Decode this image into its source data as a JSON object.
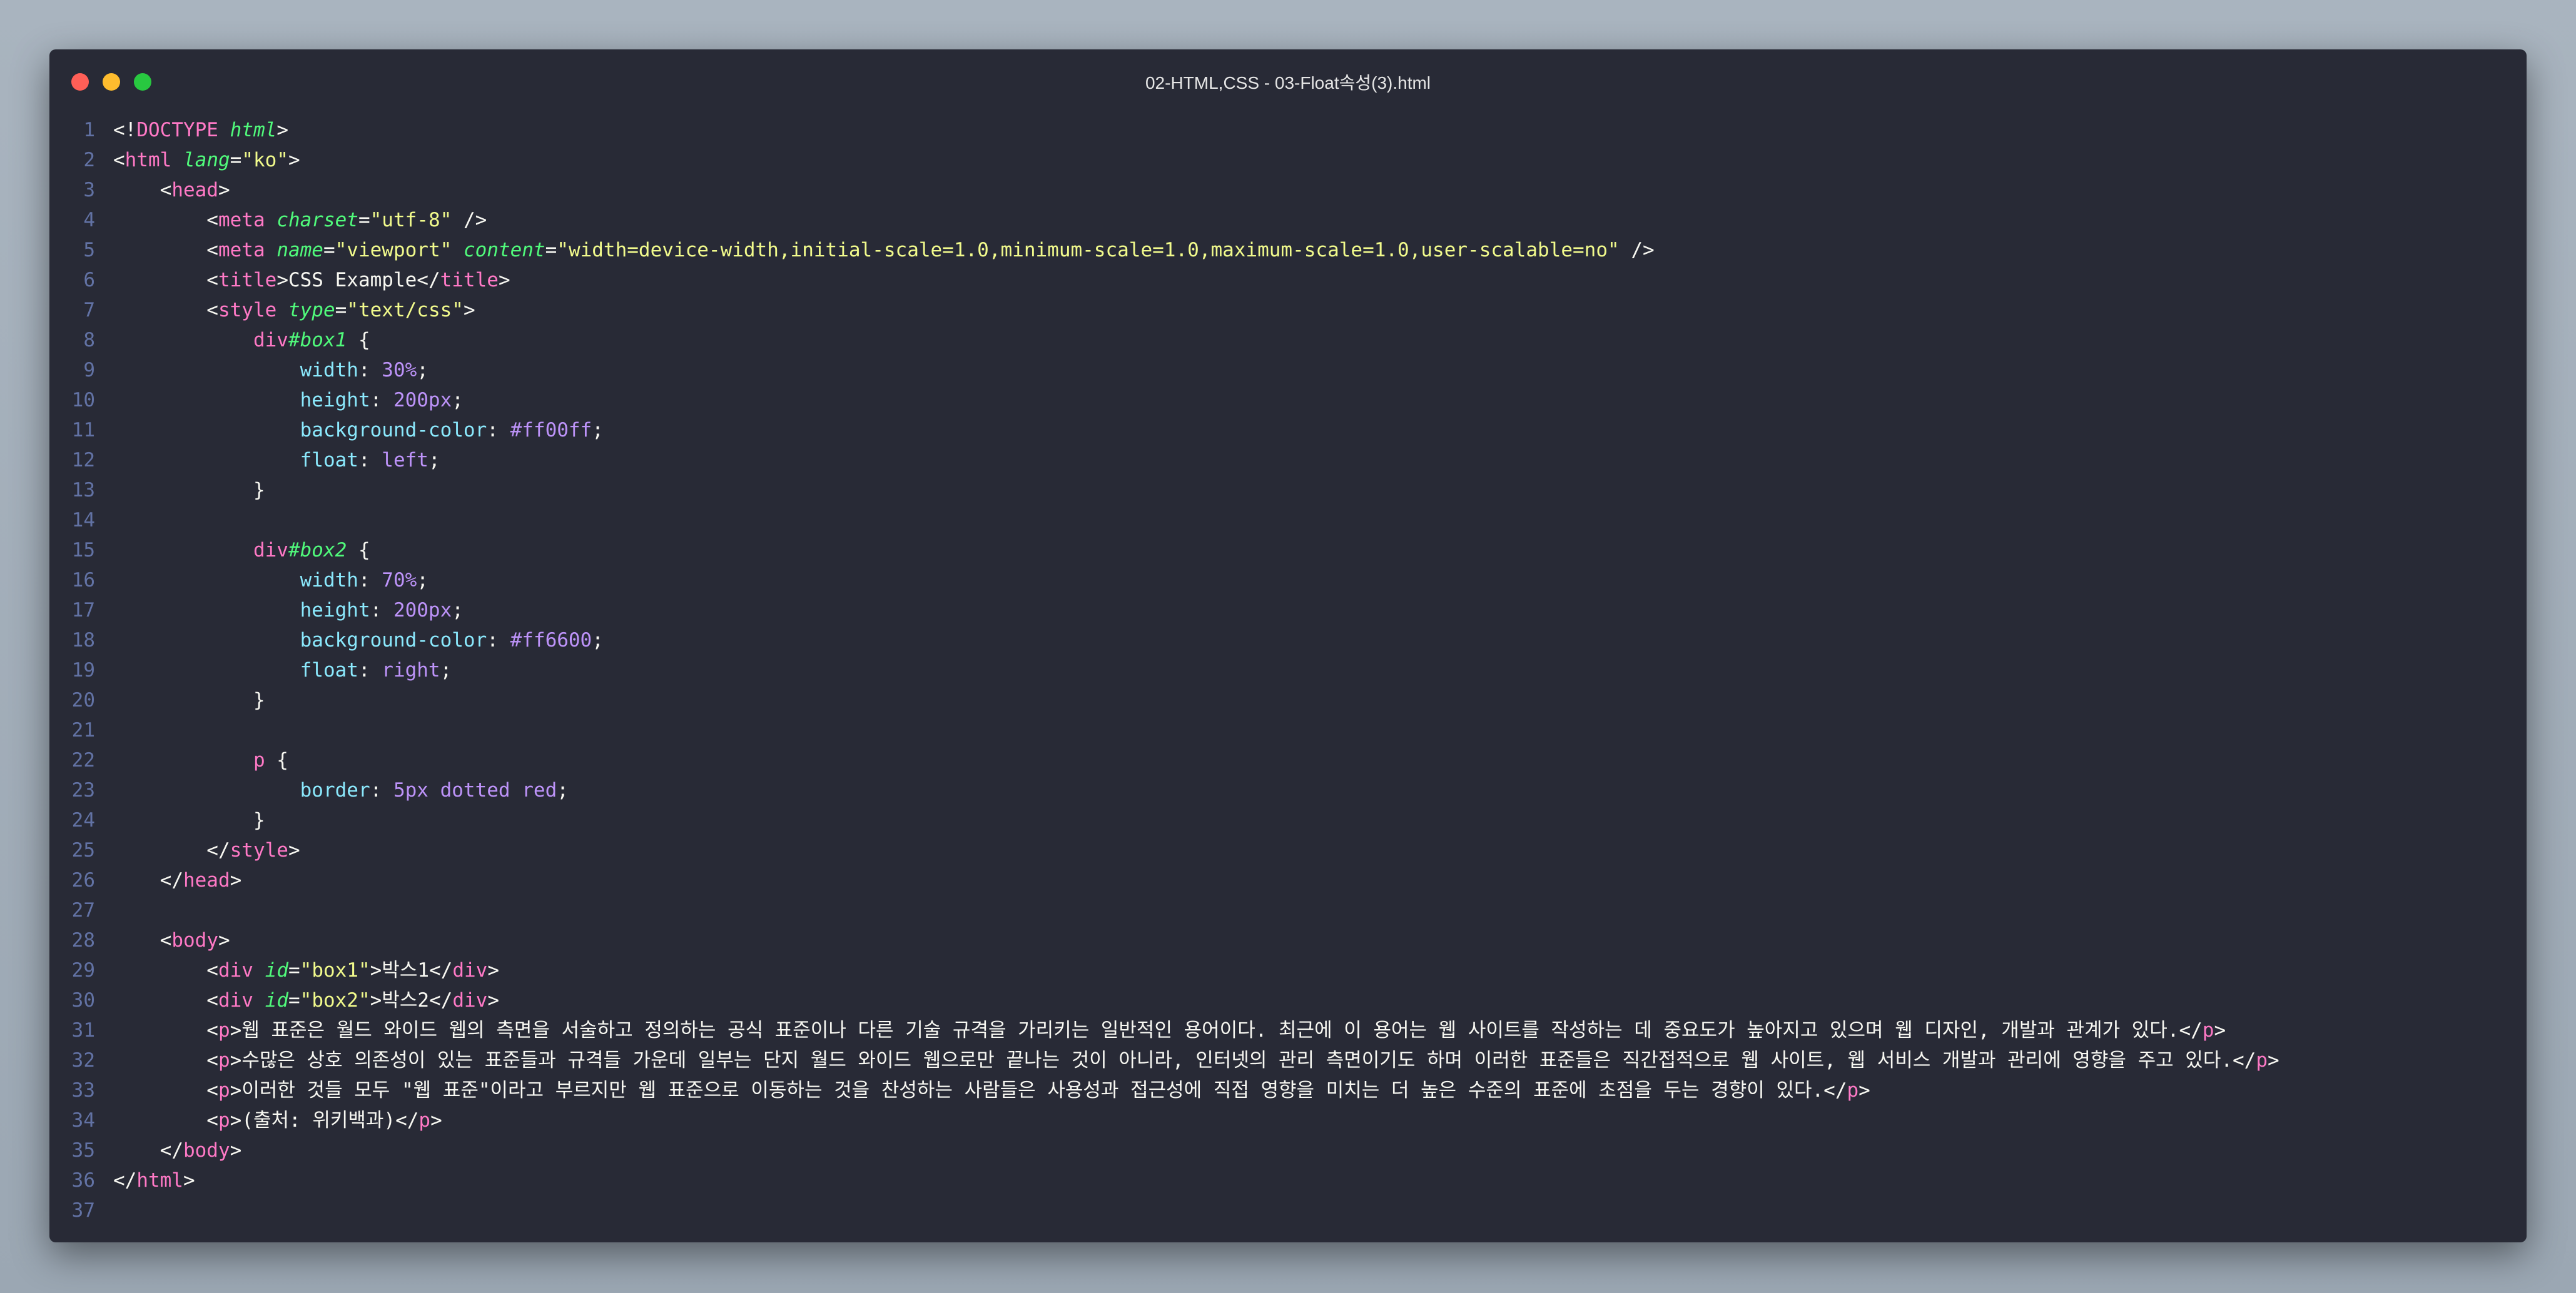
{
  "window": {
    "title": "02-HTML,CSS - 03-Float속성(3).html"
  },
  "editor": {
    "lines": [
      {
        "n": "1",
        "tokens": [
          {
            "t": "<!",
            "c": "txt"
          },
          {
            "t": "DOCTYPE",
            "c": "doc"
          },
          {
            "t": " ",
            "c": "txt"
          },
          {
            "t": "html",
            "c": "attr"
          },
          {
            "t": ">",
            "c": "txt"
          }
        ]
      },
      {
        "n": "2",
        "tokens": [
          {
            "t": "<",
            "c": "txt"
          },
          {
            "t": "html",
            "c": "tag"
          },
          {
            "t": " ",
            "c": "txt"
          },
          {
            "t": "lang",
            "c": "attr"
          },
          {
            "t": "=",
            "c": "txt"
          },
          {
            "t": "\"ko\"",
            "c": "str"
          },
          {
            "t": ">",
            "c": "txt"
          }
        ]
      },
      {
        "n": "3",
        "tokens": [
          {
            "t": "    <",
            "c": "txt"
          },
          {
            "t": "head",
            "c": "tag"
          },
          {
            "t": ">",
            "c": "txt"
          }
        ]
      },
      {
        "n": "4",
        "tokens": [
          {
            "t": "        <",
            "c": "txt"
          },
          {
            "t": "meta",
            "c": "tag"
          },
          {
            "t": " ",
            "c": "txt"
          },
          {
            "t": "charset",
            "c": "attr"
          },
          {
            "t": "=",
            "c": "txt"
          },
          {
            "t": "\"utf-8\"",
            "c": "str"
          },
          {
            "t": " />",
            "c": "txt"
          }
        ]
      },
      {
        "n": "5",
        "tokens": [
          {
            "t": "        <",
            "c": "txt"
          },
          {
            "t": "meta",
            "c": "tag"
          },
          {
            "t": " ",
            "c": "txt"
          },
          {
            "t": "name",
            "c": "attr"
          },
          {
            "t": "=",
            "c": "txt"
          },
          {
            "t": "\"viewport\"",
            "c": "str"
          },
          {
            "t": " ",
            "c": "txt"
          },
          {
            "t": "content",
            "c": "attr"
          },
          {
            "t": "=",
            "c": "txt"
          },
          {
            "t": "\"width=device-width,initial-scale=1.0,minimum-scale=1.0,maximum-scale=1.0,user-scalable=no\"",
            "c": "str"
          },
          {
            "t": " />",
            "c": "txt"
          }
        ]
      },
      {
        "n": "6",
        "tokens": [
          {
            "t": "        <",
            "c": "txt"
          },
          {
            "t": "title",
            "c": "tag"
          },
          {
            "t": ">CSS Example</",
            "c": "txt"
          },
          {
            "t": "title",
            "c": "tag"
          },
          {
            "t": ">",
            "c": "txt"
          }
        ]
      },
      {
        "n": "7",
        "tokens": [
          {
            "t": "        <",
            "c": "txt"
          },
          {
            "t": "style",
            "c": "tag"
          },
          {
            "t": " ",
            "c": "txt"
          },
          {
            "t": "type",
            "c": "attr"
          },
          {
            "t": "=",
            "c": "txt"
          },
          {
            "t": "\"text/css\"",
            "c": "str"
          },
          {
            "t": ">",
            "c": "txt"
          }
        ]
      },
      {
        "n": "8",
        "tokens": [
          {
            "t": "            ",
            "c": "txt"
          },
          {
            "t": "div",
            "c": "sel-tag"
          },
          {
            "t": "#box1",
            "c": "sel-id"
          },
          {
            "t": " {",
            "c": "txt"
          }
        ]
      },
      {
        "n": "9",
        "tokens": [
          {
            "t": "                ",
            "c": "txt"
          },
          {
            "t": "width",
            "c": "prop"
          },
          {
            "t": ": ",
            "c": "txt"
          },
          {
            "t": "30%",
            "c": "num"
          },
          {
            "t": ";",
            "c": "txt"
          }
        ]
      },
      {
        "n": "10",
        "tokens": [
          {
            "t": "                ",
            "c": "txt"
          },
          {
            "t": "height",
            "c": "prop"
          },
          {
            "t": ": ",
            "c": "txt"
          },
          {
            "t": "200px",
            "c": "num"
          },
          {
            "t": ";",
            "c": "txt"
          }
        ]
      },
      {
        "n": "11",
        "tokens": [
          {
            "t": "                ",
            "c": "txt"
          },
          {
            "t": "background-color",
            "c": "prop"
          },
          {
            "t": ": ",
            "c": "txt"
          },
          {
            "t": "#ff00ff",
            "c": "num"
          },
          {
            "t": ";",
            "c": "txt"
          }
        ]
      },
      {
        "n": "12",
        "tokens": [
          {
            "t": "                ",
            "c": "txt"
          },
          {
            "t": "float",
            "c": "prop"
          },
          {
            "t": ": ",
            "c": "txt"
          },
          {
            "t": "left",
            "c": "num"
          },
          {
            "t": ";",
            "c": "txt"
          }
        ]
      },
      {
        "n": "13",
        "tokens": [
          {
            "t": "            }",
            "c": "txt"
          }
        ]
      },
      {
        "n": "14",
        "tokens": []
      },
      {
        "n": "15",
        "tokens": [
          {
            "t": "            ",
            "c": "txt"
          },
          {
            "t": "div",
            "c": "sel-tag"
          },
          {
            "t": "#box2",
            "c": "sel-id"
          },
          {
            "t": " {",
            "c": "txt"
          }
        ]
      },
      {
        "n": "16",
        "tokens": [
          {
            "t": "                ",
            "c": "txt"
          },
          {
            "t": "width",
            "c": "prop"
          },
          {
            "t": ": ",
            "c": "txt"
          },
          {
            "t": "70%",
            "c": "num"
          },
          {
            "t": ";",
            "c": "txt"
          }
        ]
      },
      {
        "n": "17",
        "tokens": [
          {
            "t": "                ",
            "c": "txt"
          },
          {
            "t": "height",
            "c": "prop"
          },
          {
            "t": ": ",
            "c": "txt"
          },
          {
            "t": "200px",
            "c": "num"
          },
          {
            "t": ";",
            "c": "txt"
          }
        ]
      },
      {
        "n": "18",
        "tokens": [
          {
            "t": "                ",
            "c": "txt"
          },
          {
            "t": "background-color",
            "c": "prop"
          },
          {
            "t": ": ",
            "c": "txt"
          },
          {
            "t": "#ff6600",
            "c": "num"
          },
          {
            "t": ";",
            "c": "txt"
          }
        ]
      },
      {
        "n": "19",
        "tokens": [
          {
            "t": "                ",
            "c": "txt"
          },
          {
            "t": "float",
            "c": "prop"
          },
          {
            "t": ": ",
            "c": "txt"
          },
          {
            "t": "right",
            "c": "num"
          },
          {
            "t": ";",
            "c": "txt"
          }
        ]
      },
      {
        "n": "20",
        "tokens": [
          {
            "t": "            }",
            "c": "txt"
          }
        ]
      },
      {
        "n": "21",
        "tokens": []
      },
      {
        "n": "22",
        "tokens": [
          {
            "t": "            ",
            "c": "txt"
          },
          {
            "t": "p",
            "c": "sel-tag"
          },
          {
            "t": " {",
            "c": "txt"
          }
        ]
      },
      {
        "n": "23",
        "tokens": [
          {
            "t": "                ",
            "c": "txt"
          },
          {
            "t": "border",
            "c": "prop"
          },
          {
            "t": ": ",
            "c": "txt"
          },
          {
            "t": "5px dotted red",
            "c": "num"
          },
          {
            "t": ";",
            "c": "txt"
          }
        ]
      },
      {
        "n": "24",
        "tokens": [
          {
            "t": "            }",
            "c": "txt"
          }
        ]
      },
      {
        "n": "25",
        "tokens": [
          {
            "t": "        </",
            "c": "txt"
          },
          {
            "t": "style",
            "c": "tag"
          },
          {
            "t": ">",
            "c": "txt"
          }
        ]
      },
      {
        "n": "26",
        "tokens": [
          {
            "t": "    </",
            "c": "txt"
          },
          {
            "t": "head",
            "c": "tag"
          },
          {
            "t": ">",
            "c": "txt"
          }
        ]
      },
      {
        "n": "27",
        "tokens": []
      },
      {
        "n": "28",
        "tokens": [
          {
            "t": "    <",
            "c": "txt"
          },
          {
            "t": "body",
            "c": "tag"
          },
          {
            "t": ">",
            "c": "txt"
          }
        ]
      },
      {
        "n": "29",
        "tokens": [
          {
            "t": "        <",
            "c": "txt"
          },
          {
            "t": "div",
            "c": "tag"
          },
          {
            "t": " ",
            "c": "txt"
          },
          {
            "t": "id",
            "c": "attr"
          },
          {
            "t": "=",
            "c": "txt"
          },
          {
            "t": "\"box1\"",
            "c": "str"
          },
          {
            "t": ">박스1</",
            "c": "txt"
          },
          {
            "t": "div",
            "c": "tag"
          },
          {
            "t": ">",
            "c": "txt"
          }
        ]
      },
      {
        "n": "30",
        "tokens": [
          {
            "t": "        <",
            "c": "txt"
          },
          {
            "t": "div",
            "c": "tag"
          },
          {
            "t": " ",
            "c": "txt"
          },
          {
            "t": "id",
            "c": "attr"
          },
          {
            "t": "=",
            "c": "txt"
          },
          {
            "t": "\"box2\"",
            "c": "str"
          },
          {
            "t": ">박스2</",
            "c": "txt"
          },
          {
            "t": "div",
            "c": "tag"
          },
          {
            "t": ">",
            "c": "txt"
          }
        ]
      },
      {
        "n": "31",
        "tokens": [
          {
            "t": "        <",
            "c": "txt"
          },
          {
            "t": "p",
            "c": "tag"
          },
          {
            "t": ">웹 표준은 월드 와이드 웹의 측면을 서술하고 정의하는 공식 표준이나 다른 기술 규격을 가리키는 일반적인 용어이다. 최근에 이 용어는 웹 사이트를 작성하는 데 중요도가 높아지고 있으며 웹 디자인, 개발과 관계가 있다.</",
            "c": "txt"
          },
          {
            "t": "p",
            "c": "tag"
          },
          {
            "t": ">",
            "c": "txt"
          }
        ]
      },
      {
        "n": "32",
        "tokens": [
          {
            "t": "        <",
            "c": "txt"
          },
          {
            "t": "p",
            "c": "tag"
          },
          {
            "t": ">수많은 상호 의존성이 있는 표준들과 규격들 가운데 일부는 단지 월드 와이드 웹으로만 끝나는 것이 아니라, 인터넷의 관리 측면이기도 하며 이러한 표준들은 직간접적으로 웹 사이트, 웹 서비스 개발과 관리에 영향을 주고 있다.</",
            "c": "txt"
          },
          {
            "t": "p",
            "c": "tag"
          },
          {
            "t": ">",
            "c": "txt"
          }
        ]
      },
      {
        "n": "33",
        "tokens": [
          {
            "t": "        <",
            "c": "txt"
          },
          {
            "t": "p",
            "c": "tag"
          },
          {
            "t": ">이러한 것들 모두 \"웹 표준\"이라고 부르지만 웹 표준으로 이동하는 것을 찬성하는 사람들은 사용성과 접근성에 직접 영향을 미치는 더 높은 수준의 표준에 초점을 두는 경향이 있다.</",
            "c": "txt"
          },
          {
            "t": "p",
            "c": "tag"
          },
          {
            "t": ">",
            "c": "txt"
          }
        ]
      },
      {
        "n": "34",
        "tokens": [
          {
            "t": "        <",
            "c": "txt"
          },
          {
            "t": "p",
            "c": "tag"
          },
          {
            "t": ">(출처: 위키백과)</",
            "c": "txt"
          },
          {
            "t": "p",
            "c": "tag"
          },
          {
            "t": ">",
            "c": "txt"
          }
        ]
      },
      {
        "n": "35",
        "tokens": [
          {
            "t": "    </",
            "c": "txt"
          },
          {
            "t": "body",
            "c": "tag"
          },
          {
            "t": ">",
            "c": "txt"
          }
        ]
      },
      {
        "n": "36",
        "tokens": [
          {
            "t": "</",
            "c": "txt"
          },
          {
            "t": "html",
            "c": "tag"
          },
          {
            "t": ">",
            "c": "txt"
          }
        ]
      },
      {
        "n": "37",
        "tokens": []
      }
    ]
  }
}
